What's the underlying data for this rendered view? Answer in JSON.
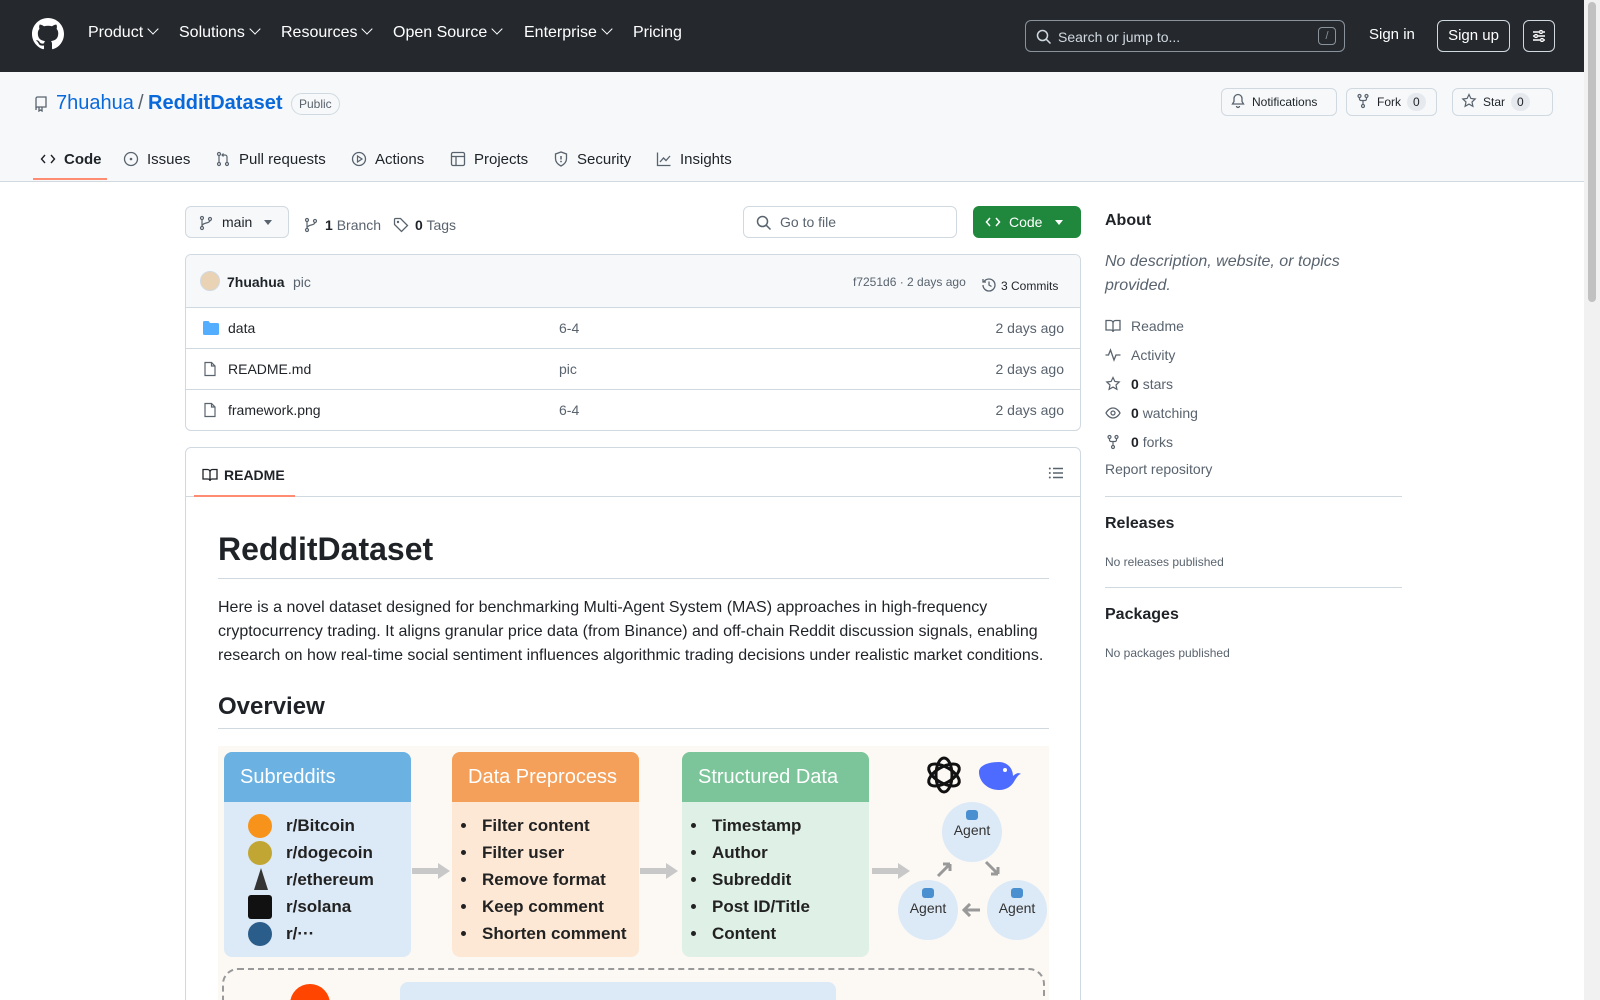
{
  "header": {
    "nav": [
      "Product",
      "Solutions",
      "Resources",
      "Open Source",
      "Enterprise",
      "Pricing"
    ],
    "search_placeholder": "Search or jump to...",
    "search_shortcut": "/",
    "sign_in": "Sign in",
    "sign_up": "Sign up"
  },
  "repo": {
    "owner": "7huahua",
    "separator": "/",
    "name": "RedditDataset",
    "visibility": "Public",
    "notifications_label": "Notifications",
    "fork_label": "Fork",
    "fork_count": "0",
    "star_label": "Star",
    "star_count": "0"
  },
  "tabs": [
    {
      "label": "Code",
      "icon": "code-icon",
      "active": true
    },
    {
      "label": "Issues",
      "icon": "issue-icon"
    },
    {
      "label": "Pull requests",
      "icon": "pull-request-icon"
    },
    {
      "label": "Actions",
      "icon": "play-icon"
    },
    {
      "label": "Projects",
      "icon": "table-icon"
    },
    {
      "label": "Security",
      "icon": "shield-icon"
    },
    {
      "label": "Insights",
      "icon": "graph-icon"
    }
  ],
  "toolbar": {
    "branch": "main",
    "branch_count": "1",
    "branch_label": "Branch",
    "tag_count": "0",
    "tag_label": "Tags",
    "go_to_file": "Go to file",
    "code_button": "Code",
    "accent": "#1f883d"
  },
  "commit": {
    "author": "7huahua",
    "message": "pic",
    "hash_time": "f7251d6 · 2 days ago",
    "commits_label": "3 Commits"
  },
  "files": [
    {
      "name": "data",
      "type": "folder",
      "message": "6-4",
      "date": "2 days ago"
    },
    {
      "name": "README.md",
      "type": "file",
      "message": "pic",
      "date": "2 days ago"
    },
    {
      "name": "framework.png",
      "type": "file",
      "message": "6-4",
      "date": "2 days ago"
    }
  ],
  "readme": {
    "tab_label": "README",
    "title": "RedditDataset",
    "paragraph": "Here is a novel dataset designed for benchmarking Multi-Agent System (MAS) approaches in high-frequency cryptocurrency trading. It aligns granular price data (from Binance) and off-chain Reddit discussion signals, enabling research on how real-time social sentiment influences algorithmic trading decisions under realistic market conditions.",
    "overview_heading": "Overview",
    "figure": {
      "subreddits_title": "Subreddits",
      "subreddits": [
        "r/Bitcoin",
        "r/dogecoin",
        "r/ethereum",
        "r/solana",
        "r/···"
      ],
      "preprocess_title": "Data Preprocess",
      "preprocess": [
        "Filter content",
        "Filter user",
        "Remove format",
        "Keep comment",
        "Shorten comment"
      ],
      "structured_title": "Structured Data",
      "structured": [
        "Timestamp",
        "Author",
        "Subreddit",
        "Post ID/Title",
        "Content"
      ],
      "agent_label": "Agent"
    }
  },
  "sidebar": {
    "about_heading": "About",
    "about_text": "No description, website, or topics provided.",
    "readme": "Readme",
    "activity": "Activity",
    "stars_count": "0",
    "stars_label": "stars",
    "watching_count": "0",
    "watching_label": "watching",
    "forks_count": "0",
    "forks_label": "forks",
    "report": "Report repository",
    "releases_heading": "Releases",
    "releases_text": "No releases published",
    "packages_heading": "Packages",
    "packages_text": "No packages published"
  }
}
